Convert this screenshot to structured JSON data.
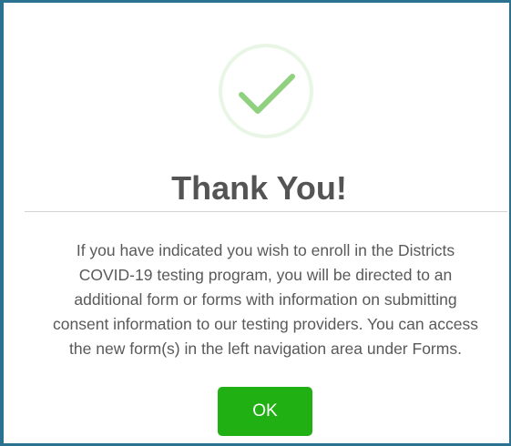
{
  "dialog": {
    "icon": "checkmark-circle-icon",
    "title": "Thank You!",
    "message_lines": [
      "If you have indicated you wish to enroll in the Districts",
      "COVID-19 testing program, you will be directed to an",
      "additional form or forms with information on submitting",
      "consent information to our testing providers. You can access",
      "the new form(s) in the left navigation area under Forms."
    ],
    "ok_label": "OK"
  },
  "colors": {
    "frame_border": "#2a7290",
    "check_ring": "#e9f6e6",
    "check_mark": "#8fd17f",
    "title_text": "#545454",
    "body_text": "#595959",
    "button_bg": "#21b014",
    "button_text": "#ffffff"
  }
}
